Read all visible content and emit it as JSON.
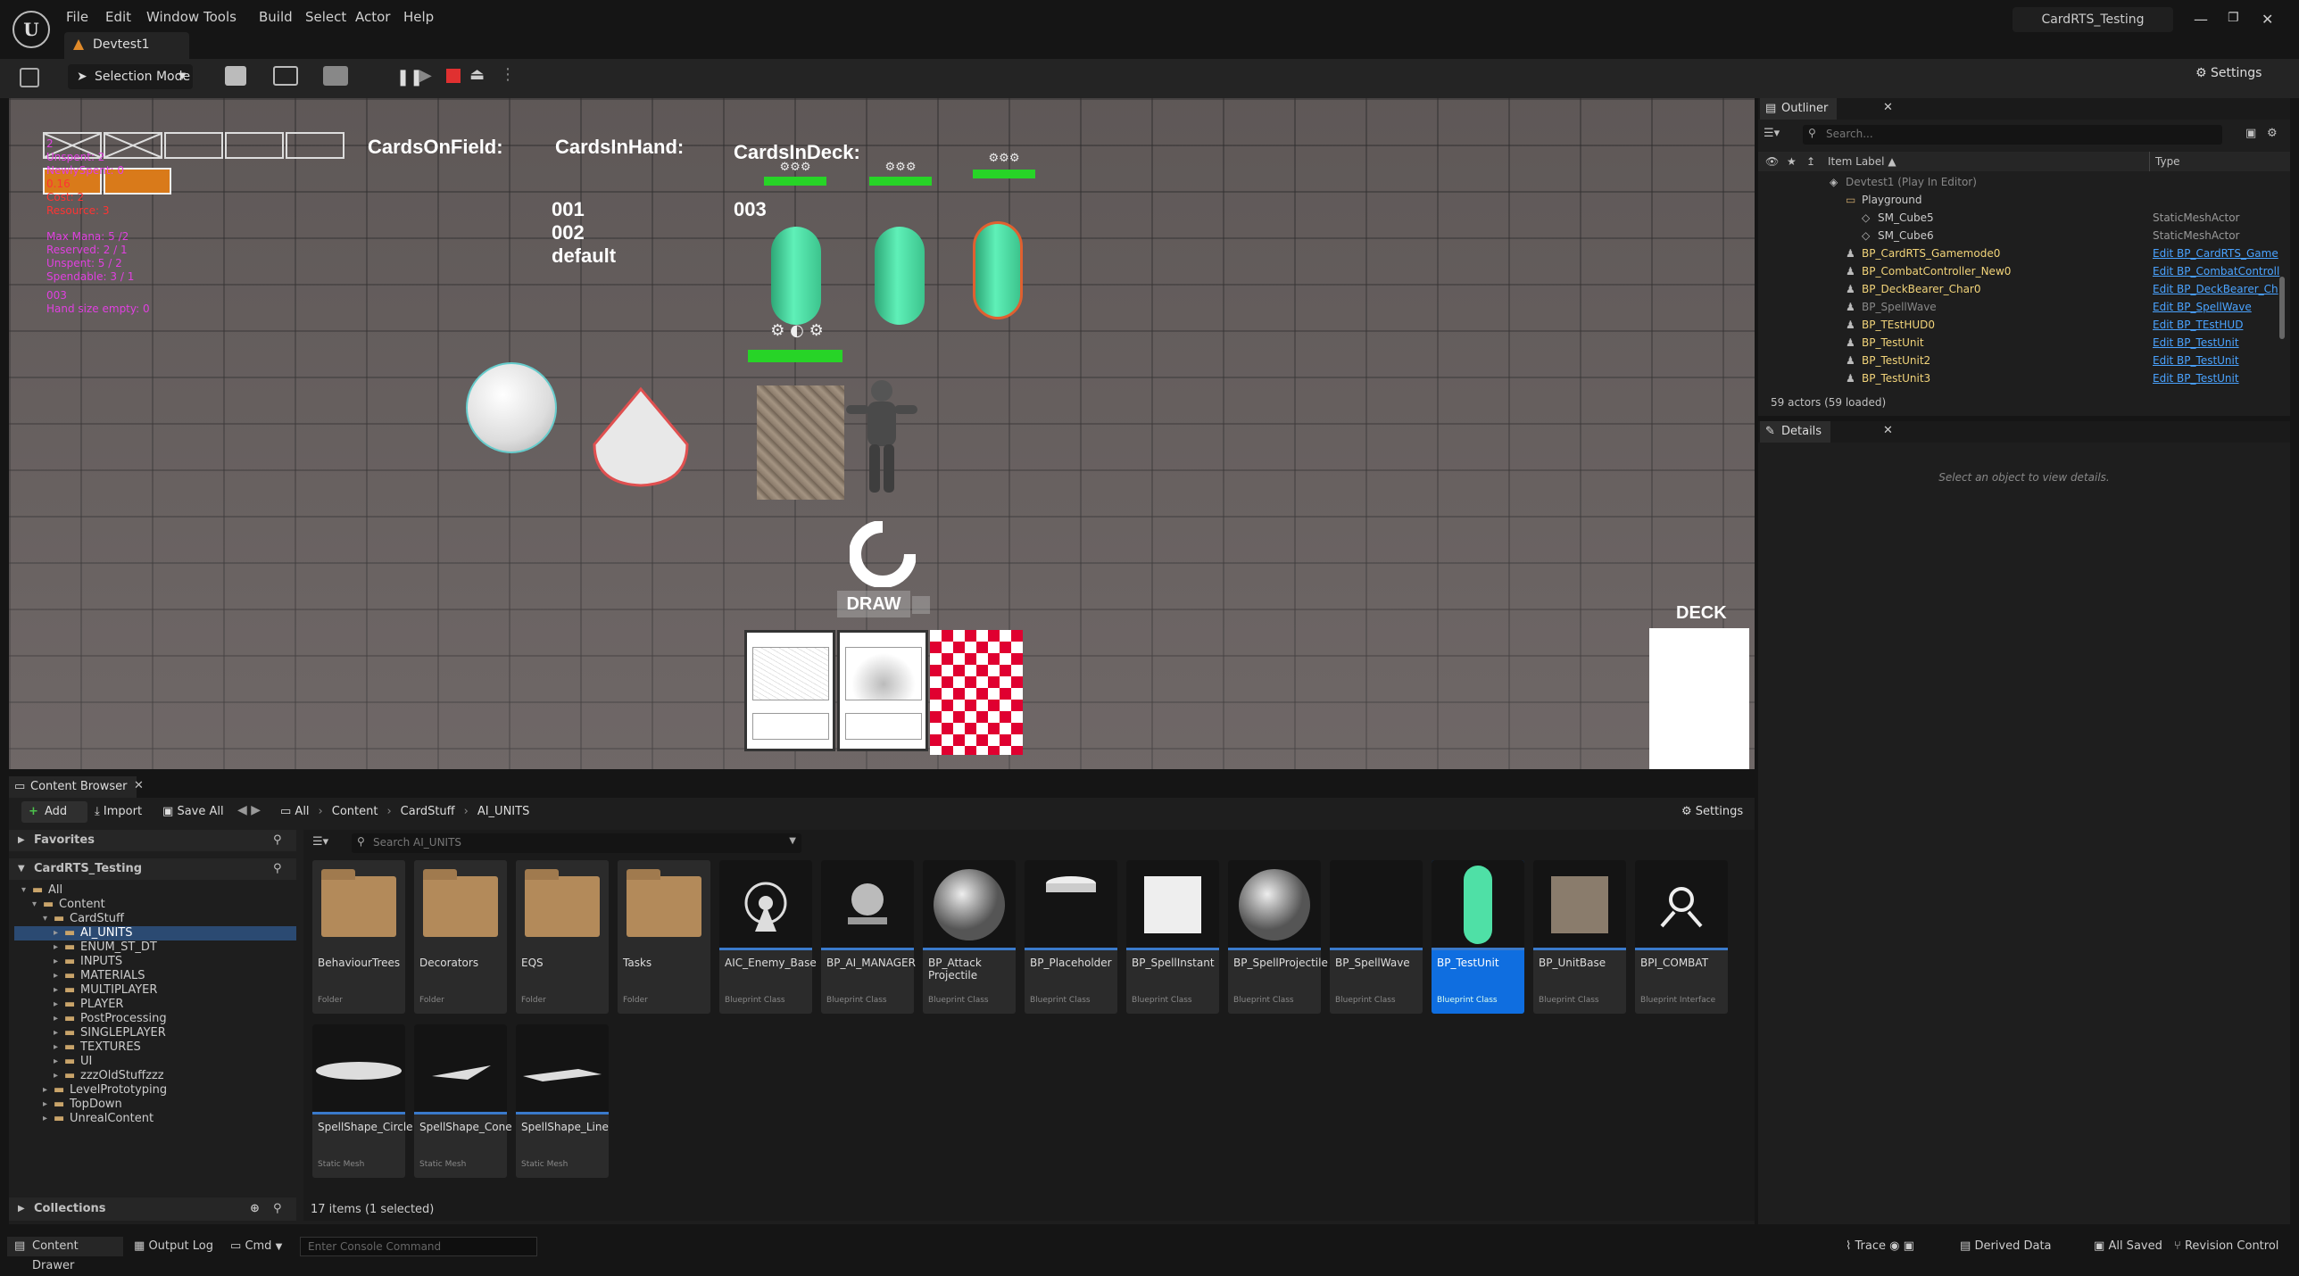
{
  "title_bar": {
    "menus": [
      "File",
      "Edit",
      "Window",
      "Tools",
      "Build",
      "Select",
      "Actor",
      "Help"
    ],
    "tab_label": "Devtest1",
    "project_name": "CardRTS_Testing"
  },
  "toolbar": {
    "selection_mode": "Selection Mode",
    "settings_label": "Settings"
  },
  "viewport": {
    "debug_lines": [
      {
        "text": "2",
        "color": "#e040e0"
      },
      {
        "text": "Unspent: 2",
        "color": "#e040e0"
      },
      {
        "text": "NewlySpent: 0",
        "color": "#e040e0"
      },
      {
        "text": "0.16",
        "color": "#ff3333"
      },
      {
        "text": "Cost: 2",
        "color": "#ff3333"
      },
      {
        "text": "Resource: 3",
        "color": "#ff3333"
      }
    ],
    "mana_lines": [
      {
        "text": "Max Mana: 5 /2",
        "color": "#e040e0"
      },
      {
        "text": "Reserved: 2 / 1",
        "color": "#e040e0"
      },
      {
        "text": "Unspent: 5 / 2",
        "color": "#e040e0"
      },
      {
        "text": "Spendable: 3 / 1",
        "color": "#e040e0"
      }
    ],
    "hand_lines": [
      {
        "text": "003",
        "color": "#e040e0"
      },
      {
        "text": "Hand size empty: 0",
        "color": "#e040e0"
      }
    ],
    "labels": {
      "field": "CardsOnField:",
      "hand": "CardsInHand:",
      "deck": "CardsInDeck:"
    },
    "hand_list": [
      "001",
      "002",
      "default"
    ],
    "deck_list": [
      "003"
    ],
    "draw_label": "DRAW",
    "deck_label": "DECK"
  },
  "outliner": {
    "tab": "Outliner",
    "search_placeholder": "Search...",
    "col_label": "Item Label ▲",
    "col_type": "Type",
    "rows": [
      {
        "label": "Devtest1 (Play In Editor)",
        "type": "",
        "indent": 0,
        "kind": "world",
        "grey": true
      },
      {
        "label": "Playground",
        "type": "",
        "indent": 1,
        "kind": "folder"
      },
      {
        "label": "SM_Cube5",
        "type": "StaticMeshActor",
        "indent": 2,
        "kind": "mesh"
      },
      {
        "label": "SM_Cube6",
        "type": "StaticMeshActor",
        "indent": 2,
        "kind": "mesh"
      },
      {
        "label": "BP_CardRTS_Gamemode0",
        "type": "Edit BP_CardRTS_Game",
        "indent": 1,
        "kind": "bp",
        "yellow": true
      },
      {
        "label": "BP_CombatController_New0",
        "type": "Edit BP_CombatControll",
        "indent": 1,
        "kind": "bp",
        "yellow": true
      },
      {
        "label": "BP_DeckBearer_Char0",
        "type": "Edit BP_DeckBearer_Ch",
        "indent": 1,
        "kind": "bp",
        "yellow": true
      },
      {
        "label": "BP_SpellWave",
        "type": "Edit BP_SpellWave",
        "indent": 1,
        "kind": "bp",
        "grey": true
      },
      {
        "label": "BP_TEstHUD0",
        "type": "Edit BP_TEstHUD",
        "indent": 1,
        "kind": "bp",
        "yellow": true
      },
      {
        "label": "BP_TestUnit",
        "type": "Edit BP_TestUnit",
        "indent": 1,
        "kind": "bp",
        "yellow": true
      },
      {
        "label": "BP_TestUnit2",
        "type": "Edit BP_TestUnit",
        "indent": 1,
        "kind": "bp",
        "yellow": true
      },
      {
        "label": "BP_TestUnit3",
        "type": "Edit BP_TestUnit",
        "indent": 1,
        "kind": "bp",
        "yellow": true
      }
    ],
    "footer": "59 actors (59 loaded)"
  },
  "details": {
    "tab": "Details",
    "empty": "Select an object to view details."
  },
  "content_browser": {
    "tab": "Content Browser",
    "add": "Add",
    "import": "Import",
    "save_all": "Save All",
    "breadcrumb": [
      "All",
      "Content",
      "CardStuff",
      "AI_UNITS"
    ],
    "settings": "Settings",
    "favorites": "Favorites",
    "project": "CardRTS_Testing",
    "search_placeholder": "Search AI_UNITS",
    "tree": [
      {
        "label": "All",
        "indent": 0
      },
      {
        "label": "Content",
        "indent": 1
      },
      {
        "label": "CardStuff",
        "indent": 2
      },
      {
        "label": "AI_UNITS",
        "indent": 3,
        "selected": true
      },
      {
        "label": "ENUM_ST_DT",
        "indent": 3
      },
      {
        "label": "INPUTS",
        "indent": 3
      },
      {
        "label": "MATERIALS",
        "indent": 3
      },
      {
        "label": "MULTIPLAYER",
        "indent": 3
      },
      {
        "label": "PLAYER",
        "indent": 3
      },
      {
        "label": "PostProcessing",
        "indent": 3
      },
      {
        "label": "SINGLEPLAYER",
        "indent": 3
      },
      {
        "label": "TEXTURES",
        "indent": 3
      },
      {
        "label": "UI",
        "indent": 3
      },
      {
        "label": "zzzOldStuffzzz",
        "indent": 3
      },
      {
        "label": "LevelPrototyping",
        "indent": 2
      },
      {
        "label": "TopDown",
        "indent": 2
      },
      {
        "label": "UnrealContent",
        "indent": 2
      }
    ],
    "assets": [
      {
        "name": "BehaviourTrees",
        "type": "Folder",
        "kind": "folder"
      },
      {
        "name": "Decorators",
        "type": "Folder",
        "kind": "folder"
      },
      {
        "name": "EQS",
        "type": "Folder",
        "kind": "folder"
      },
      {
        "name": "Tasks",
        "type": "Folder",
        "kind": "folder"
      },
      {
        "name": "AIC_Enemy_Base",
        "type": "Blueprint Class",
        "kind": "aic"
      },
      {
        "name": "BP_AI_MANAGER",
        "type": "Blueprint Class",
        "kind": "sphere-small"
      },
      {
        "name": "BP_Attack Projectile",
        "type": "Blueprint Class",
        "kind": "sphere"
      },
      {
        "name": "BP_Placeholder",
        "type": "Blueprint Class",
        "kind": "disc"
      },
      {
        "name": "BP_SpellInstant",
        "type": "Blueprint Class",
        "kind": "cube"
      },
      {
        "name": "BP_SpellProjectile",
        "type": "Blueprint Class",
        "kind": "sphere"
      },
      {
        "name": "BP_SpellWave",
        "type": "Blueprint Class",
        "kind": "empty"
      },
      {
        "name": "BP_TestUnit",
        "type": "Blueprint Class",
        "kind": "capsule",
        "selected": true
      },
      {
        "name": "BP_UnitBase",
        "type": "Blueprint Class",
        "kind": "stonecube"
      },
      {
        "name": "BPI_COMBAT",
        "type": "Blueprint Interface",
        "kind": "interface"
      },
      {
        "name": "SpellShape_Circle",
        "type": "Static Mesh",
        "kind": "plate"
      },
      {
        "name": "SpellShape_Cone",
        "type": "Static Mesh",
        "kind": "cone"
      },
      {
        "name": "SpellShape_Line",
        "type": "Static Mesh",
        "kind": "line"
      }
    ],
    "item_count": "17 items (1 selected)",
    "collections": "Collections"
  },
  "status_bar": {
    "content_drawer": "Content Drawer",
    "output_log": "Output Log",
    "cmd": "Cmd",
    "console_placeholder": "Enter Console Command",
    "trace": "Trace",
    "derived_data": "Derived Data",
    "all_saved": "All Saved",
    "revision_control": "Revision Control"
  }
}
